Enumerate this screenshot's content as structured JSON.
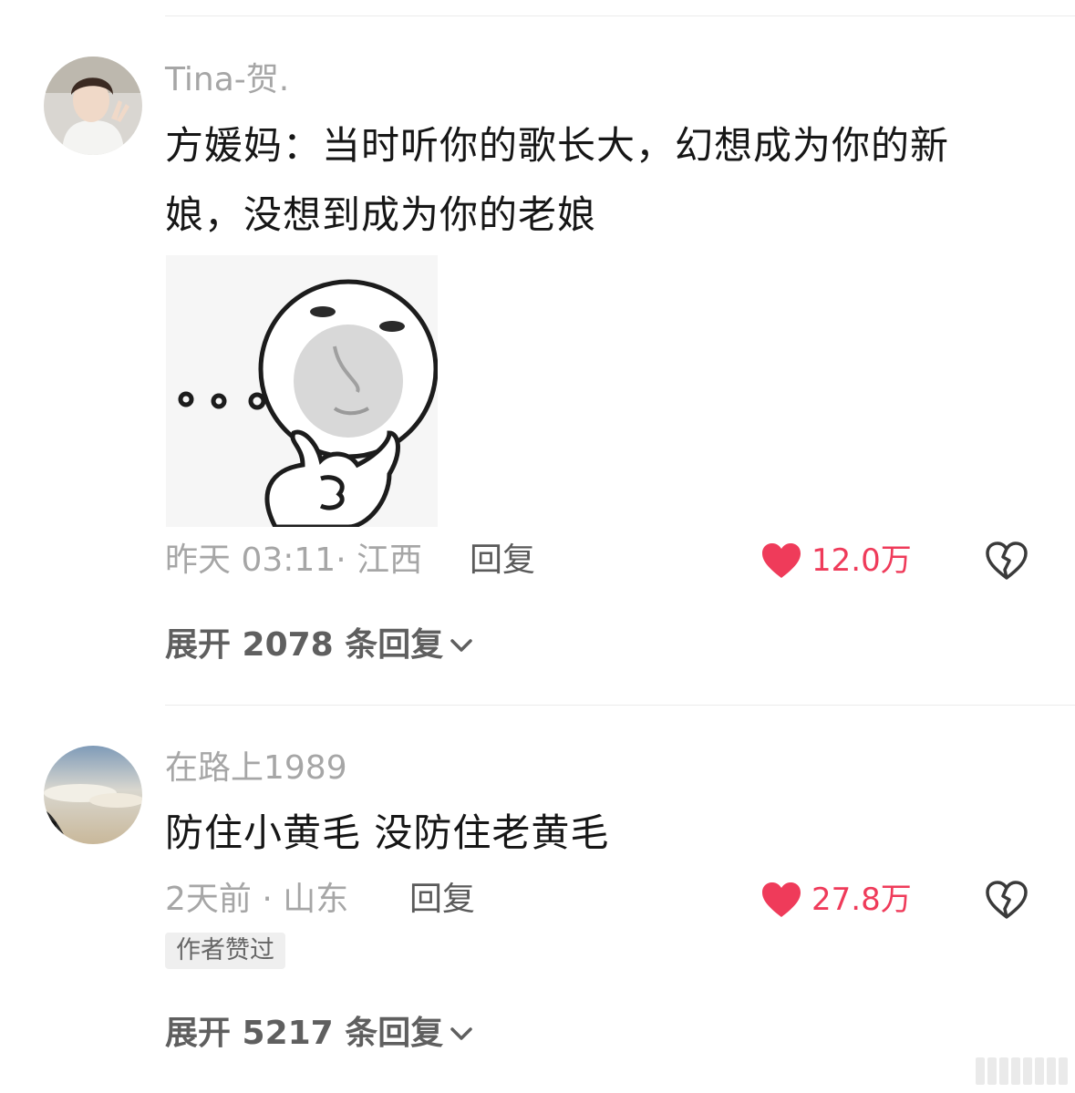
{
  "comments": [
    {
      "username": "Tina-贺.",
      "content": "方媛妈：当时听你的歌长大，幻想成为你的新娘，没想到成为你的老娘",
      "time": "昨天 03:11",
      "location": "江西",
      "meta": "昨天 03:11· 江西",
      "reply_label": "回复",
      "likes": "12.0万",
      "expand_label": "展开 2078 条回复"
    },
    {
      "username": "在路上1989",
      "content": "防住小黄毛 没防住老黄毛",
      "time": "2天前",
      "location": "山东",
      "meta": "2天前 · 山东",
      "reply_label": "回复",
      "likes": "27.8万",
      "badge": "作者赞过",
      "expand_label": "展开 5217 条回复"
    }
  ],
  "colors": {
    "like": "#ef3b5a",
    "muted_text": "#a6a6a6",
    "body_text": "#161616"
  },
  "icons": {
    "like": "heart-icon",
    "dislike": "broken-heart-icon",
    "expand": "chevron-down-icon"
  }
}
